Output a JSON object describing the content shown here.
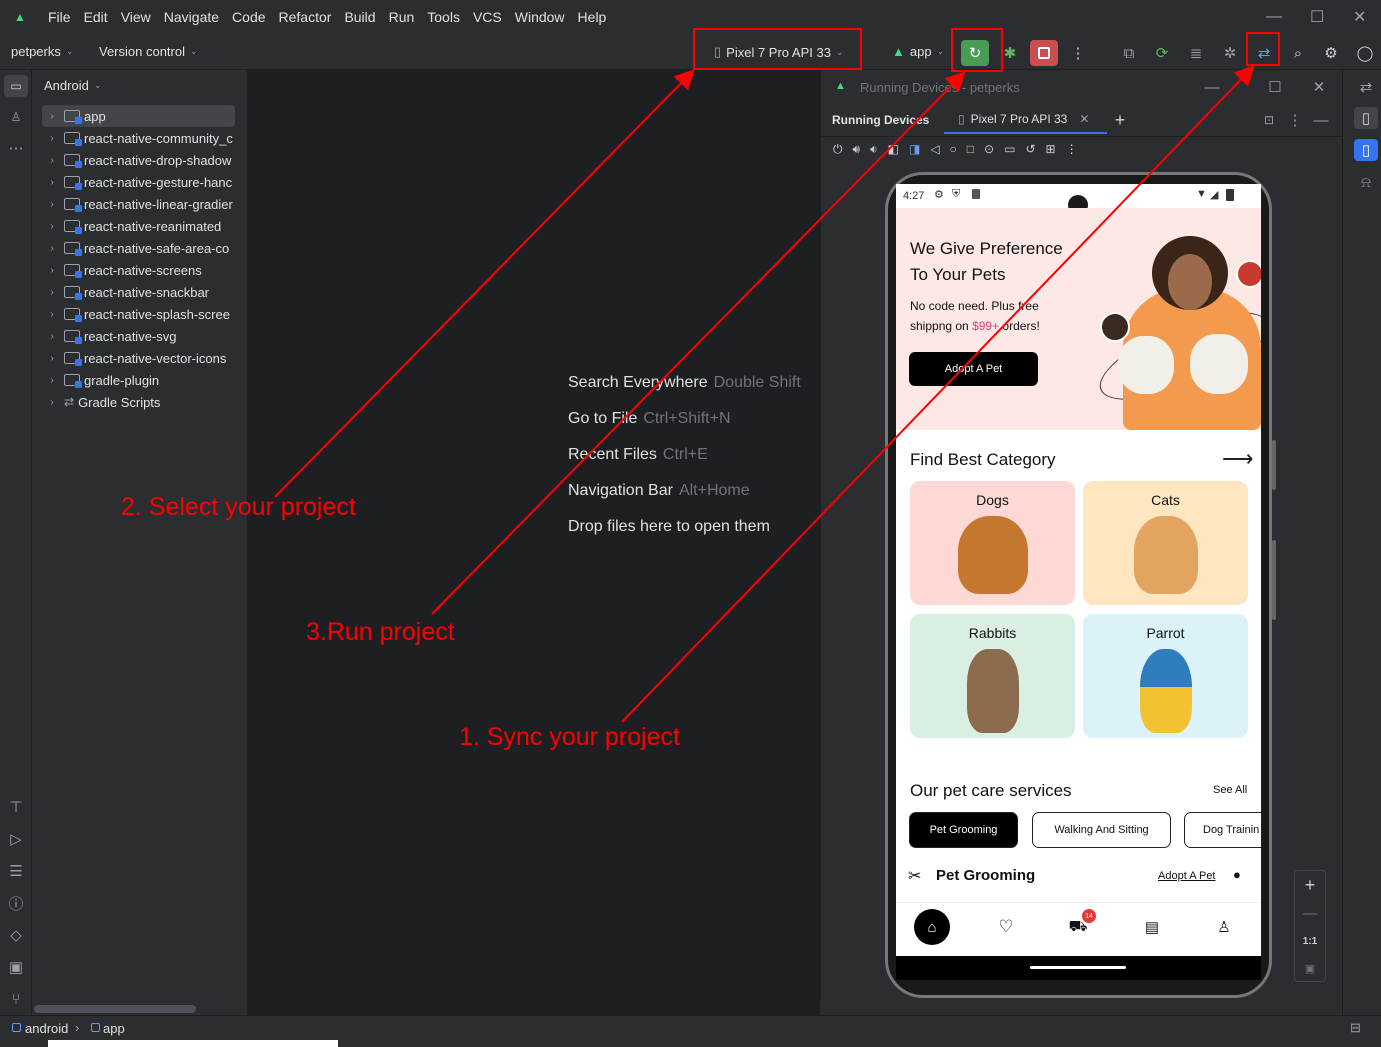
{
  "menubar": {
    "items": [
      "File",
      "Edit",
      "View",
      "Navigate",
      "Code",
      "Refactor",
      "Build",
      "Run",
      "Tools",
      "VCS",
      "Window",
      "Help"
    ]
  },
  "toolbar": {
    "project": "petperks",
    "vcs": "Version control",
    "device": "Pixel 7 Pro API 33",
    "config": "app"
  },
  "project_pane": {
    "view": "Android",
    "items": [
      "app",
      "react-native-community_c",
      "react-native-drop-shadow",
      "react-native-gesture-hanc",
      "react-native-linear-gradier",
      "react-native-reanimated",
      "react-native-safe-area-co",
      "react-native-screens",
      "react-native-snackbar",
      "react-native-splash-scree",
      "react-native-svg",
      "react-native-vector-icons",
      "gradle-plugin",
      "Gradle Scripts"
    ]
  },
  "editor_hints": [
    {
      "label": "Search Everywhere",
      "key": "Double Shift"
    },
    {
      "label": "Go to File",
      "key": "Ctrl+Shift+N"
    },
    {
      "label": "Recent Files",
      "key": "Ctrl+E"
    },
    {
      "label": "Navigation Bar",
      "key": "Alt+Home"
    },
    {
      "label": "Drop files here to open them",
      "key": ""
    }
  ],
  "devices_panel": {
    "title": "Running Devices - petperks",
    "tab_running": "Running Devices",
    "tab_device": "Pixel 7 Pro API 33",
    "zoom_label": "1:1"
  },
  "phone": {
    "time": "4:27",
    "hero_title_1": "We Give Preference",
    "hero_title_2": "To Your Pets",
    "hero_text_1": "No code need. Plus free",
    "hero_text_2a": "shippng on ",
    "hero_price": "$99+",
    "hero_text_2b": " orders!",
    "hero_button": "Adopt A Pet",
    "category_heading": "Find Best Category",
    "categories": [
      "Dogs",
      "Cats",
      "Rabbits",
      "Parrot"
    ],
    "services_heading": "Our pet care services",
    "see_all": "See All",
    "service_tabs": [
      "Pet Grooming",
      "Walking And Sitting",
      "Dog Trainin"
    ],
    "grooming_heading": "Pet Grooming",
    "adopt_link": "Adopt A Pet",
    "cart_badge": "14"
  },
  "annotations": {
    "step1": "1. Sync your project",
    "step2": "2. Select your project",
    "step3": "3.Run project"
  },
  "statusbar": {
    "crumb1": "android",
    "crumb2": "app"
  },
  "colors": {
    "run_green": "#499c54",
    "stop_red": "#c94f4f",
    "annotation_red": "#ff0000",
    "accent_blue": "#3574f0"
  }
}
